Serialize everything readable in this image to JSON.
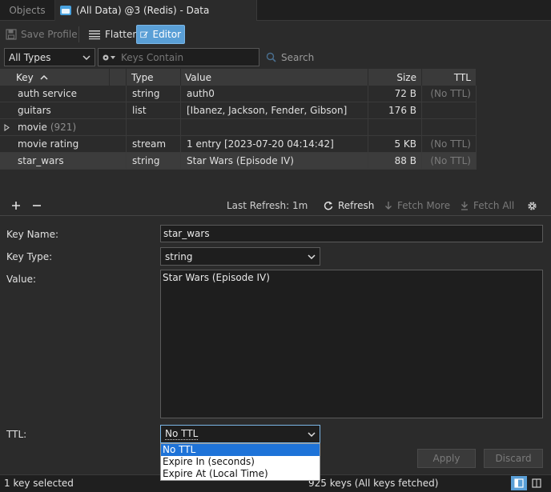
{
  "tabs": {
    "objects_label": "Objects",
    "data_label": "(All Data) @3 (Redis) - Data"
  },
  "toolbar": {
    "save_profile": "Save Profile",
    "flatten": "Flatten",
    "editor": "Editor"
  },
  "filter": {
    "type_selected": "All Types",
    "search_placeholder": "Keys Contain",
    "search_label": "Search"
  },
  "table": {
    "headers": {
      "key": "Key",
      "type": "Type",
      "value": "Value",
      "size": "Size",
      "ttl": "TTL"
    },
    "rows": [
      {
        "key": "auth service",
        "type": "string",
        "value": "auth0",
        "size": "72 B",
        "ttl": "(No TTL)"
      },
      {
        "key": "guitars",
        "type": "list",
        "value": "[Ibanez, Jackson, Fender, Gibson]",
        "size": "176 B",
        "ttl": ""
      },
      {
        "key": "movie",
        "count": "(921)",
        "type": "",
        "value": "",
        "size": "",
        "ttl": ""
      },
      {
        "key": "movie rating",
        "type": "stream",
        "value": "1 entry [2023-07-20 04:14:42]",
        "size": "5 KB",
        "ttl": "(No TTL)"
      },
      {
        "key": "star_wars",
        "type": "string",
        "value": "Star Wars (Episode IV)",
        "size": "88 B",
        "ttl": "(No TTL)"
      }
    ]
  },
  "table_footer": {
    "last_refresh": "Last Refresh: 1m",
    "refresh": "Refresh",
    "fetch_more": "Fetch More",
    "fetch_all": "Fetch All"
  },
  "editor": {
    "key_name_label": "Key Name:",
    "key_name_value": "star_wars",
    "key_type_label": "Key Type:",
    "key_type_value": "string",
    "value_label": "Value:",
    "value_text": "Star Wars (Episode IV)",
    "ttl_label": "TTL:",
    "ttl_value": "No TTL",
    "ttl_options": [
      "No TTL",
      "Expire In (seconds)",
      "Expire At (Local Time)"
    ],
    "apply": "Apply",
    "discard": "Discard"
  },
  "status": {
    "left": "1 key selected",
    "center": "925 keys (All keys fetched)"
  },
  "colors": {
    "accent": "#5a9fd6",
    "background": "#2b2b2b",
    "selected_menu": "#1e73d8"
  }
}
